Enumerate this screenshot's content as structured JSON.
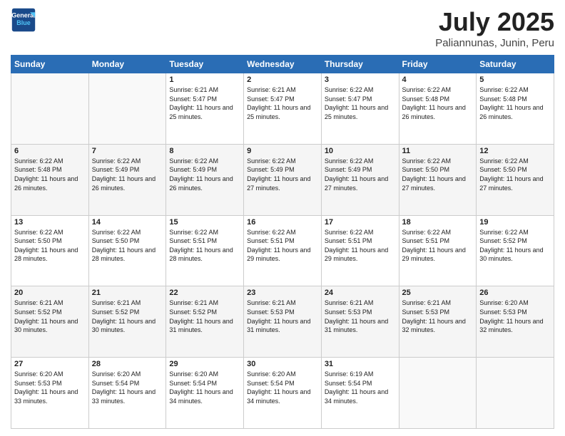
{
  "logo": {
    "line1": "General",
    "line2": "Blue"
  },
  "title": "July 2025",
  "location": "Paliannunas, Junin, Peru",
  "days_of_week": [
    "Sunday",
    "Monday",
    "Tuesday",
    "Wednesday",
    "Thursday",
    "Friday",
    "Saturday"
  ],
  "weeks": [
    [
      {
        "day": "",
        "sunrise": "",
        "sunset": "",
        "daylight": ""
      },
      {
        "day": "",
        "sunrise": "",
        "sunset": "",
        "daylight": ""
      },
      {
        "day": "1",
        "sunrise": "Sunrise: 6:21 AM",
        "sunset": "Sunset: 5:47 PM",
        "daylight": "Daylight: 11 hours and 25 minutes."
      },
      {
        "day": "2",
        "sunrise": "Sunrise: 6:21 AM",
        "sunset": "Sunset: 5:47 PM",
        "daylight": "Daylight: 11 hours and 25 minutes."
      },
      {
        "day": "3",
        "sunrise": "Sunrise: 6:22 AM",
        "sunset": "Sunset: 5:47 PM",
        "daylight": "Daylight: 11 hours and 25 minutes."
      },
      {
        "day": "4",
        "sunrise": "Sunrise: 6:22 AM",
        "sunset": "Sunset: 5:48 PM",
        "daylight": "Daylight: 11 hours and 26 minutes."
      },
      {
        "day": "5",
        "sunrise": "Sunrise: 6:22 AM",
        "sunset": "Sunset: 5:48 PM",
        "daylight": "Daylight: 11 hours and 26 minutes."
      }
    ],
    [
      {
        "day": "6",
        "sunrise": "Sunrise: 6:22 AM",
        "sunset": "Sunset: 5:48 PM",
        "daylight": "Daylight: 11 hours and 26 minutes."
      },
      {
        "day": "7",
        "sunrise": "Sunrise: 6:22 AM",
        "sunset": "Sunset: 5:49 PM",
        "daylight": "Daylight: 11 hours and 26 minutes."
      },
      {
        "day": "8",
        "sunrise": "Sunrise: 6:22 AM",
        "sunset": "Sunset: 5:49 PM",
        "daylight": "Daylight: 11 hours and 26 minutes."
      },
      {
        "day": "9",
        "sunrise": "Sunrise: 6:22 AM",
        "sunset": "Sunset: 5:49 PM",
        "daylight": "Daylight: 11 hours and 27 minutes."
      },
      {
        "day": "10",
        "sunrise": "Sunrise: 6:22 AM",
        "sunset": "Sunset: 5:49 PM",
        "daylight": "Daylight: 11 hours and 27 minutes."
      },
      {
        "day": "11",
        "sunrise": "Sunrise: 6:22 AM",
        "sunset": "Sunset: 5:50 PM",
        "daylight": "Daylight: 11 hours and 27 minutes."
      },
      {
        "day": "12",
        "sunrise": "Sunrise: 6:22 AM",
        "sunset": "Sunset: 5:50 PM",
        "daylight": "Daylight: 11 hours and 27 minutes."
      }
    ],
    [
      {
        "day": "13",
        "sunrise": "Sunrise: 6:22 AM",
        "sunset": "Sunset: 5:50 PM",
        "daylight": "Daylight: 11 hours and 28 minutes."
      },
      {
        "day": "14",
        "sunrise": "Sunrise: 6:22 AM",
        "sunset": "Sunset: 5:50 PM",
        "daylight": "Daylight: 11 hours and 28 minutes."
      },
      {
        "day": "15",
        "sunrise": "Sunrise: 6:22 AM",
        "sunset": "Sunset: 5:51 PM",
        "daylight": "Daylight: 11 hours and 28 minutes."
      },
      {
        "day": "16",
        "sunrise": "Sunrise: 6:22 AM",
        "sunset": "Sunset: 5:51 PM",
        "daylight": "Daylight: 11 hours and 29 minutes."
      },
      {
        "day": "17",
        "sunrise": "Sunrise: 6:22 AM",
        "sunset": "Sunset: 5:51 PM",
        "daylight": "Daylight: 11 hours and 29 minutes."
      },
      {
        "day": "18",
        "sunrise": "Sunrise: 6:22 AM",
        "sunset": "Sunset: 5:51 PM",
        "daylight": "Daylight: 11 hours and 29 minutes."
      },
      {
        "day": "19",
        "sunrise": "Sunrise: 6:22 AM",
        "sunset": "Sunset: 5:52 PM",
        "daylight": "Daylight: 11 hours and 30 minutes."
      }
    ],
    [
      {
        "day": "20",
        "sunrise": "Sunrise: 6:21 AM",
        "sunset": "Sunset: 5:52 PM",
        "daylight": "Daylight: 11 hours and 30 minutes."
      },
      {
        "day": "21",
        "sunrise": "Sunrise: 6:21 AM",
        "sunset": "Sunset: 5:52 PM",
        "daylight": "Daylight: 11 hours and 30 minutes."
      },
      {
        "day": "22",
        "sunrise": "Sunrise: 6:21 AM",
        "sunset": "Sunset: 5:52 PM",
        "daylight": "Daylight: 11 hours and 31 minutes."
      },
      {
        "day": "23",
        "sunrise": "Sunrise: 6:21 AM",
        "sunset": "Sunset: 5:53 PM",
        "daylight": "Daylight: 11 hours and 31 minutes."
      },
      {
        "day": "24",
        "sunrise": "Sunrise: 6:21 AM",
        "sunset": "Sunset: 5:53 PM",
        "daylight": "Daylight: 11 hours and 31 minutes."
      },
      {
        "day": "25",
        "sunrise": "Sunrise: 6:21 AM",
        "sunset": "Sunset: 5:53 PM",
        "daylight": "Daylight: 11 hours and 32 minutes."
      },
      {
        "day": "26",
        "sunrise": "Sunrise: 6:20 AM",
        "sunset": "Sunset: 5:53 PM",
        "daylight": "Daylight: 11 hours and 32 minutes."
      }
    ],
    [
      {
        "day": "27",
        "sunrise": "Sunrise: 6:20 AM",
        "sunset": "Sunset: 5:53 PM",
        "daylight": "Daylight: 11 hours and 33 minutes."
      },
      {
        "day": "28",
        "sunrise": "Sunrise: 6:20 AM",
        "sunset": "Sunset: 5:54 PM",
        "daylight": "Daylight: 11 hours and 33 minutes."
      },
      {
        "day": "29",
        "sunrise": "Sunrise: 6:20 AM",
        "sunset": "Sunset: 5:54 PM",
        "daylight": "Daylight: 11 hours and 34 minutes."
      },
      {
        "day": "30",
        "sunrise": "Sunrise: 6:20 AM",
        "sunset": "Sunset: 5:54 PM",
        "daylight": "Daylight: 11 hours and 34 minutes."
      },
      {
        "day": "31",
        "sunrise": "Sunrise: 6:19 AM",
        "sunset": "Sunset: 5:54 PM",
        "daylight": "Daylight: 11 hours and 34 minutes."
      },
      {
        "day": "",
        "sunrise": "",
        "sunset": "",
        "daylight": ""
      },
      {
        "day": "",
        "sunrise": "",
        "sunset": "",
        "daylight": ""
      }
    ]
  ]
}
